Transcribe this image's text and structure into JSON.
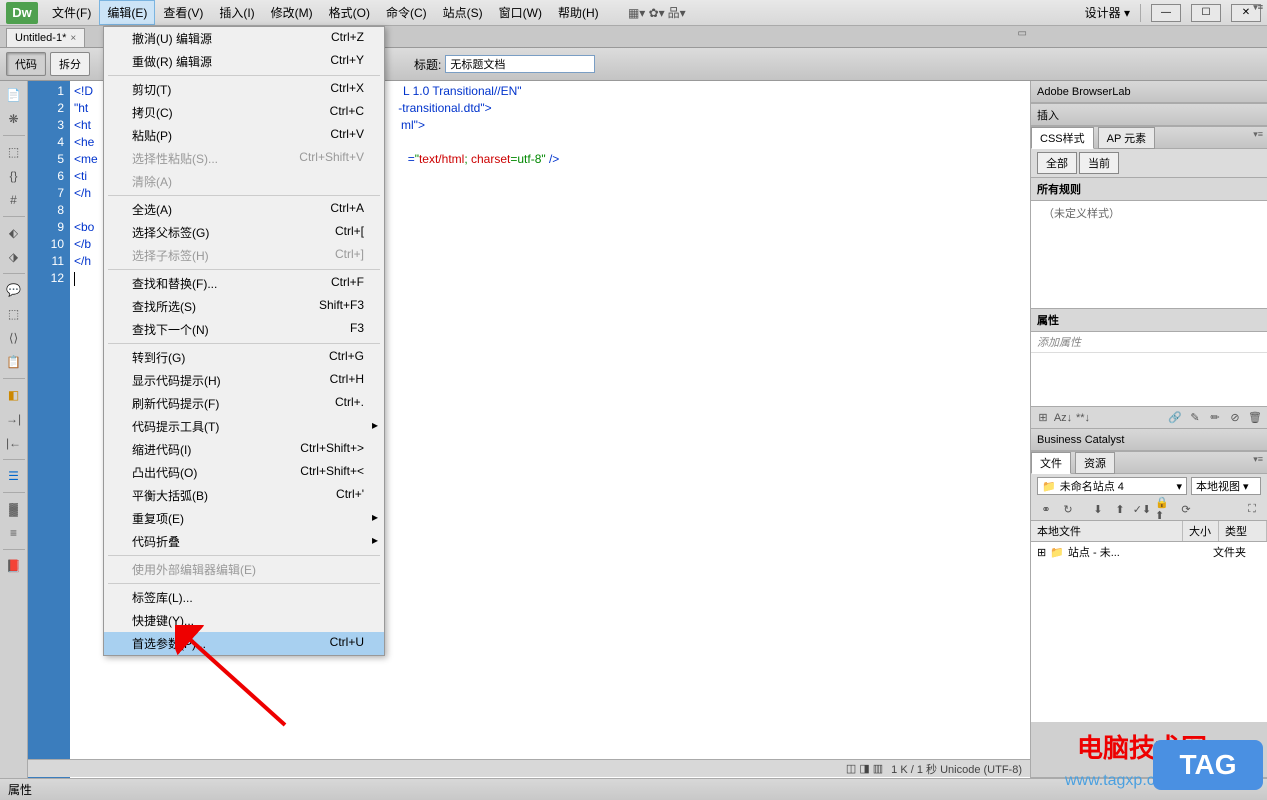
{
  "menubar": {
    "logo": "Dw",
    "items": [
      "文件(F)",
      "编辑(E)",
      "查看(V)",
      "插入(I)",
      "修改(M)",
      "格式(O)",
      "命令(C)",
      "站点(S)",
      "窗口(W)",
      "帮助(H)"
    ],
    "active_index": 1,
    "designer": "设计器",
    "win_min": "—",
    "win_max": "☐",
    "win_close": "✕"
  },
  "dropdown": {
    "groups": [
      [
        {
          "label": "撤消(U) 编辑源",
          "shortcut": "Ctrl+Z",
          "disabled": false
        },
        {
          "label": "重做(R) 编辑源",
          "shortcut": "Ctrl+Y",
          "disabled": false
        }
      ],
      [
        {
          "label": "剪切(T)",
          "shortcut": "Ctrl+X",
          "disabled": false
        },
        {
          "label": "拷贝(C)",
          "shortcut": "Ctrl+C",
          "disabled": false
        },
        {
          "label": "粘贴(P)",
          "shortcut": "Ctrl+V",
          "disabled": false
        },
        {
          "label": "选择性粘贴(S)...",
          "shortcut": "Ctrl+Shift+V",
          "disabled": true
        },
        {
          "label": "清除(A)",
          "shortcut": "",
          "disabled": true
        }
      ],
      [
        {
          "label": "全选(A)",
          "shortcut": "Ctrl+A",
          "disabled": false
        },
        {
          "label": "选择父标签(G)",
          "shortcut": "Ctrl+[",
          "disabled": false
        },
        {
          "label": "选择子标签(H)",
          "shortcut": "Ctrl+]",
          "disabled": true
        }
      ],
      [
        {
          "label": "查找和替换(F)...",
          "shortcut": "Ctrl+F",
          "disabled": false
        },
        {
          "label": "查找所选(S)",
          "shortcut": "Shift+F3",
          "disabled": false
        },
        {
          "label": "查找下一个(N)",
          "shortcut": "F3",
          "disabled": false
        }
      ],
      [
        {
          "label": "转到行(G)",
          "shortcut": "Ctrl+G",
          "disabled": false
        },
        {
          "label": "显示代码提示(H)",
          "shortcut": "Ctrl+H",
          "disabled": false
        },
        {
          "label": "刷新代码提示(F)",
          "shortcut": "Ctrl+.",
          "disabled": false
        },
        {
          "label": "代码提示工具(T)",
          "shortcut": "",
          "disabled": false,
          "arrow": true
        },
        {
          "label": "缩进代码(I)",
          "shortcut": "Ctrl+Shift+>",
          "disabled": false
        },
        {
          "label": "凸出代码(O)",
          "shortcut": "Ctrl+Shift+<",
          "disabled": false
        },
        {
          "label": "平衡大括弧(B)",
          "shortcut": "Ctrl+'",
          "disabled": false
        },
        {
          "label": "重复项(E)",
          "shortcut": "",
          "disabled": false,
          "arrow": true
        },
        {
          "label": "代码折叠",
          "shortcut": "",
          "disabled": false,
          "arrow": true
        }
      ],
      [
        {
          "label": "使用外部编辑器编辑(E)",
          "shortcut": "",
          "disabled": true
        }
      ],
      [
        {
          "label": "标签库(L)...",
          "shortcut": "",
          "disabled": false
        },
        {
          "label": "快捷键(Y)...",
          "shortcut": "",
          "disabled": false
        },
        {
          "label": "首选参数(P)...",
          "shortcut": "Ctrl+U",
          "disabled": false,
          "highlighted": true
        }
      ]
    ]
  },
  "doc_tab": {
    "name": "Untitled-1*",
    "close": "×"
  },
  "viewbar": {
    "code": "代码",
    "split": "拆分",
    "title_label": "标题:",
    "title_value": "无标题文档"
  },
  "editor": {
    "lines": [
      "1",
      "2",
      "3",
      "4",
      "5",
      "6",
      "7",
      "8",
      "9",
      "10",
      "11",
      "12"
    ],
    "code_visible": [
      {
        "prefix": "<!D",
        "rest": "L 1.0 Transitional//EN\""
      },
      {
        "prefix": "\"ht",
        "rest": "-transitional.dtd\">"
      },
      {
        "prefix": "<ht",
        "rest": "ml\">"
      },
      {
        "prefix": "<he",
        "rest": ""
      },
      {
        "prefix": "<me",
        "rest": "=\"text/html; charset=utf-8\" />"
      },
      {
        "prefix": "<ti",
        "rest": ""
      },
      {
        "prefix": "</h",
        "rest": ""
      },
      {
        "prefix": "",
        "rest": ""
      },
      {
        "prefix": "<bo",
        "rest": ""
      },
      {
        "prefix": "</b",
        "rest": ""
      },
      {
        "prefix": "</h",
        "rest": ""
      },
      {
        "prefix": "",
        "rest": ""
      }
    ]
  },
  "status": {
    "info": "1 K / 1 秒 Unicode (UTF-8)"
  },
  "properties_label": "属性",
  "panels": {
    "browserlab": "Adobe BrowserLab",
    "insert": "插入",
    "css": {
      "tab1": "CSS样式",
      "tab2": "AP 元素",
      "all": "全部",
      "current": "当前",
      "rules_header": "所有规则",
      "no_rules": "（未定义样式）",
      "props_header": "属性",
      "add_prop": "添加属性"
    },
    "bc": "Business Catalyst",
    "files": {
      "tab1": "文件",
      "tab2": "资源",
      "site": "未命名站点 4",
      "view": "本地视图",
      "col1": "本地文件",
      "col2": "大小",
      "col3": "类型",
      "row_name": "站点 - 未...",
      "row_type": "文件夹"
    }
  },
  "watermarks": {
    "text1": "电脑技术网",
    "text2": "www.tagxp.com",
    "badge": "TAG"
  }
}
